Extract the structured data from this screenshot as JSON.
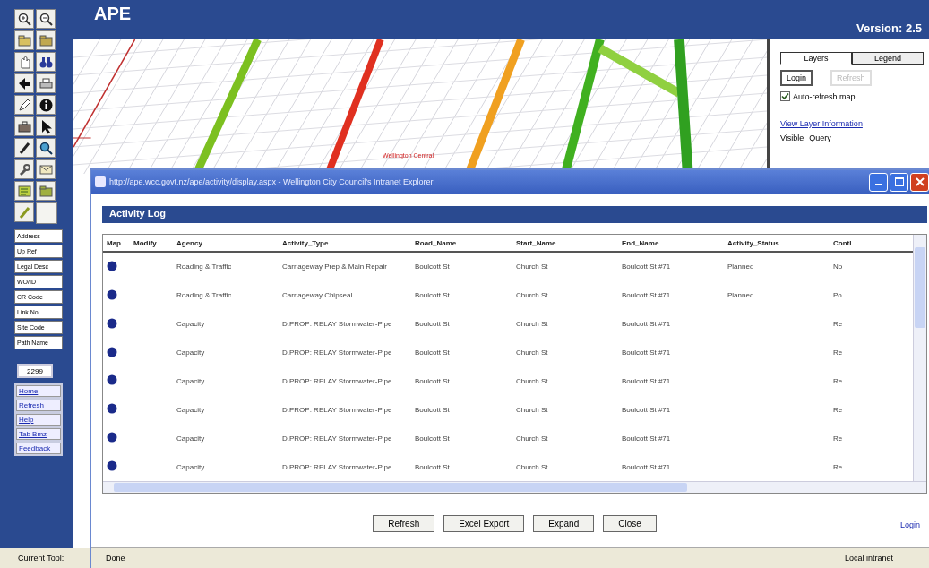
{
  "app": {
    "title": "APE",
    "version": "Version: 2.5"
  },
  "sidebar": {
    "search_buttons": [
      "Address",
      "Up Ref",
      "Legal Desc",
      "WO/ID",
      "CR Code",
      "Link No",
      "Site Code",
      "Path Name"
    ],
    "scale": "2299",
    "links": [
      "Home",
      "Refresh",
      "Help",
      "Tab Bmz",
      "Feedback"
    ]
  },
  "map": {
    "label": "Wellington Central"
  },
  "layer_panel": {
    "tabs": [
      {
        "label": "Layers",
        "selected": true
      },
      {
        "label": "Legend",
        "selected": false
      }
    ],
    "buttons": [
      {
        "label": "Login",
        "disabled": false
      },
      {
        "label": "Refresh",
        "disabled": true
      }
    ],
    "auto_refresh": {
      "label": "Auto-refresh map",
      "checked": true
    },
    "link": "View Layer Information",
    "columns": [
      "Visible",
      "Query"
    ]
  },
  "status_bar": {
    "text": "Current Tool: "
  },
  "popup": {
    "title": "http://ape.wcc.govt.nz/ape/activity/display.aspx - Wellington City Council's Intranet Explorer",
    "heading": "Activity Log",
    "table": {
      "columns": [
        "Map",
        "Modify",
        "Agency",
        "Activity_Type",
        "Road_Name",
        "Start_Name",
        "End_Name",
        "Activity_Status",
        "Contl"
      ],
      "rows": [
        [
          "",
          "",
          "Roading & Traffic",
          "Carriageway Prep & Main Repair",
          "Boulcott St",
          "Church St",
          "Boulcott St #71",
          "Planned",
          "No"
        ],
        [
          "",
          "",
          "Roading & Traffic",
          "Carriageway Chipseal",
          "Boulcott St",
          "Church St",
          "Boulcott St #71",
          "Planned",
          "Po"
        ],
        [
          "",
          "",
          "Capacity",
          "D.PROP: RELAY Stormwater-Pipe",
          "Boulcott St",
          "Church St",
          "Boulcott St #71",
          "",
          "Re"
        ],
        [
          "",
          "",
          "Capacity",
          "D.PROP: RELAY Stormwater-Pipe",
          "Boulcott St",
          "Church St",
          "Boulcott St #71",
          "",
          "Re"
        ],
        [
          "",
          "",
          "Capacity",
          "D.PROP: RELAY Stormwater-Pipe",
          "Boulcott St",
          "Church St",
          "Boulcott St #71",
          "",
          "Re"
        ],
        [
          "",
          "",
          "Capacity",
          "D.PROP: RELAY Stormwater-Pipe",
          "Boulcott St",
          "Church St",
          "Boulcott St #71",
          "",
          "Re"
        ],
        [
          "",
          "",
          "Capacity",
          "D.PROP: RELAY Stormwater-Pipe",
          "Boulcott St",
          "Church St",
          "Boulcott St #71",
          "",
          "Re"
        ],
        [
          "",
          "",
          "Capacity",
          "D.PROP: RELAY Stormwater-Pipe",
          "Boulcott St",
          "Church St",
          "Boulcott St #71",
          "",
          "Re"
        ]
      ]
    },
    "buttons": [
      "Refresh",
      "Excel Export",
      "Expand",
      "Close"
    ],
    "login_link": "Login",
    "status": {
      "text": "Done",
      "zone": "Local intranet"
    }
  }
}
